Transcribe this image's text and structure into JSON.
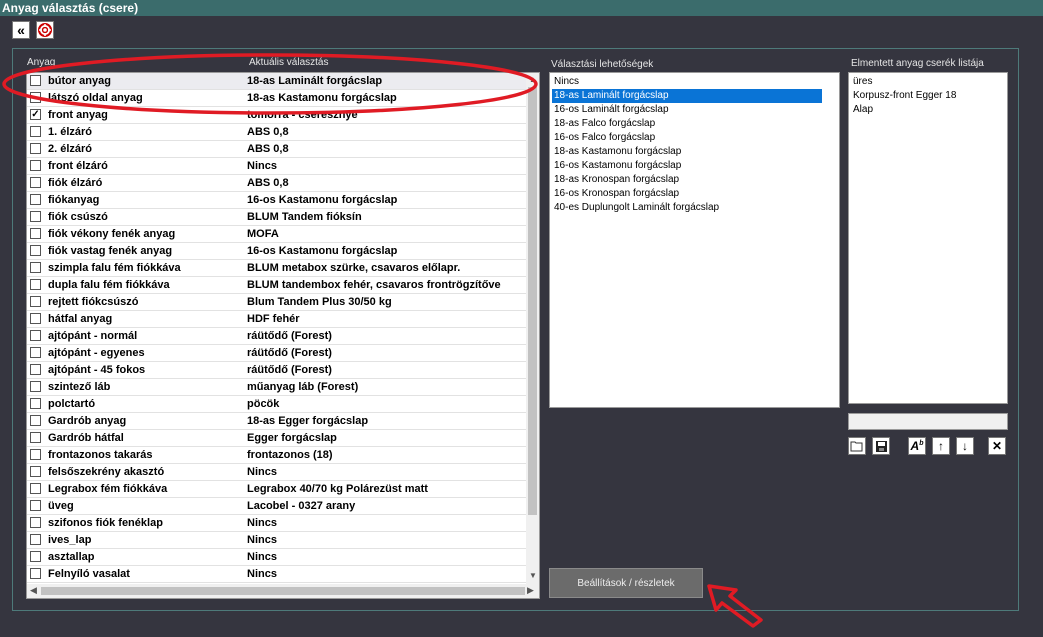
{
  "window": {
    "title": "Anyag választás (csere)"
  },
  "toolbar": {
    "back_icon": "«",
    "lifebuoy_icon": "lifebuoy-icon"
  },
  "left": {
    "col1_header": "Anyag",
    "col2_header": "Aktuális választás",
    "rows": [
      {
        "material": "bútor anyag",
        "current": "18-as Laminált forgácslap",
        "checked": false
      },
      {
        "material": "látszó oldal anyag",
        "current": "18-as Kastamonu forgácslap",
        "checked": false
      },
      {
        "material": "front anyag",
        "current": "tomorra - cseresznye",
        "checked": true
      },
      {
        "material": "1. élzáró",
        "current": "ABS 0,8",
        "checked": false
      },
      {
        "material": "2. élzáró",
        "current": "ABS 0,8",
        "checked": false
      },
      {
        "material": "front élzáró",
        "current": "Nincs",
        "checked": false
      },
      {
        "material": "fiók élzáró",
        "current": "ABS 0,8",
        "checked": false
      },
      {
        "material": "fiókanyag",
        "current": "16-os Kastamonu forgácslap",
        "checked": false
      },
      {
        "material": "fiók csúszó",
        "current": "BLUM Tandem fióksín",
        "checked": false
      },
      {
        "material": "fiók vékony fenék anyag",
        "current": "MOFA",
        "checked": false
      },
      {
        "material": "fiók vastag fenék anyag",
        "current": "16-os Kastamonu forgácslap",
        "checked": false
      },
      {
        "material": "szimpla falu fém fiókkáva",
        "current": "BLUM metabox szürke, csavaros előlapr.",
        "checked": false
      },
      {
        "material": "dupla falu fém fiókkáva",
        "current": "BLUM tandembox fehér, csavaros frontrögzítőve",
        "checked": false
      },
      {
        "material": "rejtett fiókcsúszó",
        "current": "Blum Tandem Plus 30/50 kg",
        "checked": false
      },
      {
        "material": "hátfal anyag",
        "current": "HDF fehér",
        "checked": false
      },
      {
        "material": "ajtópánt - normál",
        "current": "ráütődő (Forest)",
        "checked": false
      },
      {
        "material": "ajtópánt - egyenes",
        "current": "ráütődő (Forest)",
        "checked": false
      },
      {
        "material": "ajtópánt - 45 fokos",
        "current": "ráütődő (Forest)",
        "checked": false
      },
      {
        "material": "szintező láb",
        "current": "műanyag láb (Forest)",
        "checked": false
      },
      {
        "material": "polctartó",
        "current": "pöcök",
        "checked": false
      },
      {
        "material": "Gardrób anyag",
        "current": "18-as Egger forgácslap",
        "checked": false
      },
      {
        "material": "Gardrób hátfal",
        "current": "Egger forgácslap",
        "checked": false
      },
      {
        "material": "frontazonos takarás",
        "current": "frontazonos (18)",
        "checked": false
      },
      {
        "material": "felsőszekrény akasztó",
        "current": "Nincs",
        "checked": false
      },
      {
        "material": "Legrabox fém fiókkáva",
        "current": "Legrabox 40/70 kg Polárezüst matt",
        "checked": false
      },
      {
        "material": "üveg",
        "current": "Lacobel - 0327 arany",
        "checked": false
      },
      {
        "material": "szifonos fiók fenéklap",
        "current": "Nincs",
        "checked": false
      },
      {
        "material": "ives_lap",
        "current": "Nincs",
        "checked": false
      },
      {
        "material": "asztallap",
        "current": "Nincs",
        "checked": false
      },
      {
        "material": "Felnyíló vasalat",
        "current": "Nincs",
        "checked": false
      }
    ]
  },
  "options": {
    "header": "Választási lehetőségek",
    "items": [
      "Nincs",
      "18-as Laminált forgácslap",
      "16-os Laminált forgácslap",
      "18-as Falco forgácslap",
      "16-os Falco forgácslap",
      "18-as Kastamonu forgácslap",
      "16-os Kastamonu forgácslap",
      "18-as Kronospan forgácslap",
      "16-os Kronospan forgácslap",
      "40-es Duplungolt Laminált forgácslap"
    ],
    "selected": 1
  },
  "saved": {
    "header": "Elmentett anyag cserék listája",
    "items": [
      "üres",
      "Korpusz-front Egger 18",
      "Alap"
    ],
    "name_input": ""
  },
  "buttons": {
    "settings": "Beállítások / részletek",
    "folder_icon": "folder-icon",
    "save_icon": "save-icon",
    "rename_icon": "rename-icon",
    "up_icon": "↑",
    "down_icon": "↓",
    "delete_icon": "✕"
  }
}
